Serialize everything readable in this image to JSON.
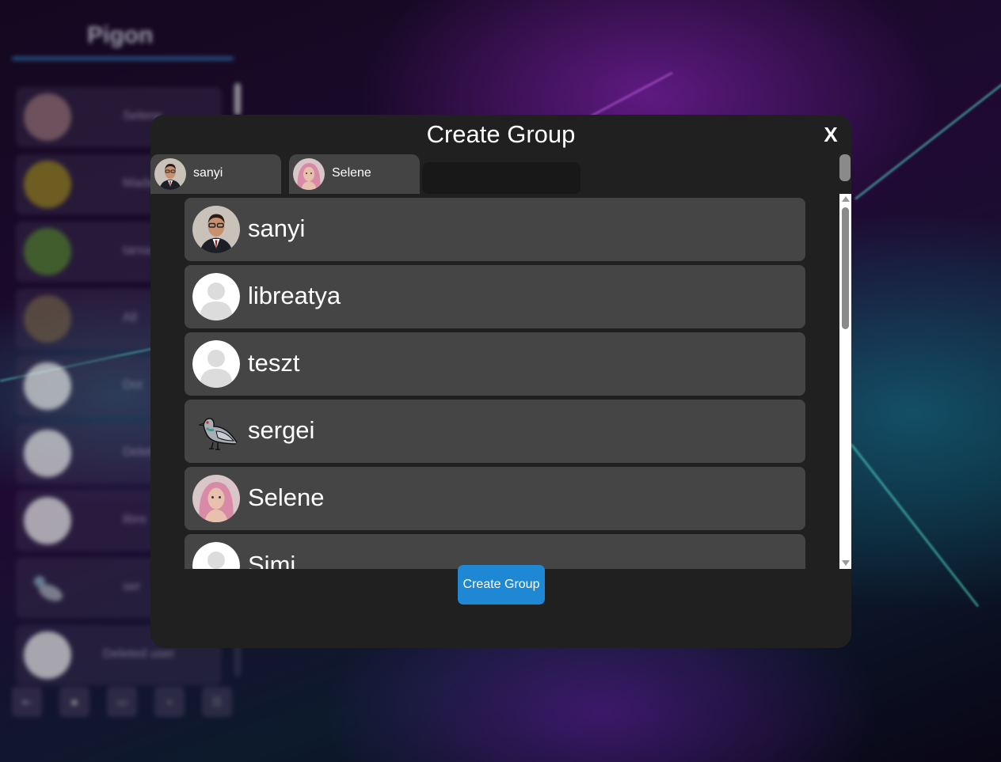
{
  "background_app": {
    "title": "Pigon",
    "contacts": [
      {
        "label": "Selene"
      },
      {
        "label": "Madar"
      },
      {
        "label": "tarsa"
      },
      {
        "label": "All"
      },
      {
        "label": "Dor"
      },
      {
        "label": "Deleted"
      },
      {
        "label": "libre"
      },
      {
        "label": "ser"
      },
      {
        "label": "Deleted user"
      }
    ],
    "toolbar_icons": [
      "exit-icon",
      "stop-icon",
      "chat-icon",
      "plus-icon",
      "users-icon"
    ]
  },
  "modal": {
    "title": "Create Group",
    "close_label": "X",
    "selected_members": [
      {
        "name": "sanyi",
        "avatar": "photo-man-suit"
      },
      {
        "name": "Selene",
        "avatar": "photo-woman-pink-hair"
      }
    ],
    "search": {
      "value": "",
      "placeholder": ""
    },
    "users": [
      {
        "name": "sanyi",
        "avatar": "photo-man-suit"
      },
      {
        "name": "libreatya",
        "avatar": "default-avatar"
      },
      {
        "name": "teszt",
        "avatar": "default-avatar"
      },
      {
        "name": "sergei",
        "avatar": "pigeon-icon"
      },
      {
        "name": "Selene",
        "avatar": "photo-woman-pink-hair"
      },
      {
        "name": "Simi",
        "avatar": "default-avatar"
      }
    ],
    "create_button_label": "Create Group"
  },
  "colors": {
    "modal_bg": "#202020",
    "row_bg": "#454545",
    "accent_button": "#1e88d4"
  }
}
